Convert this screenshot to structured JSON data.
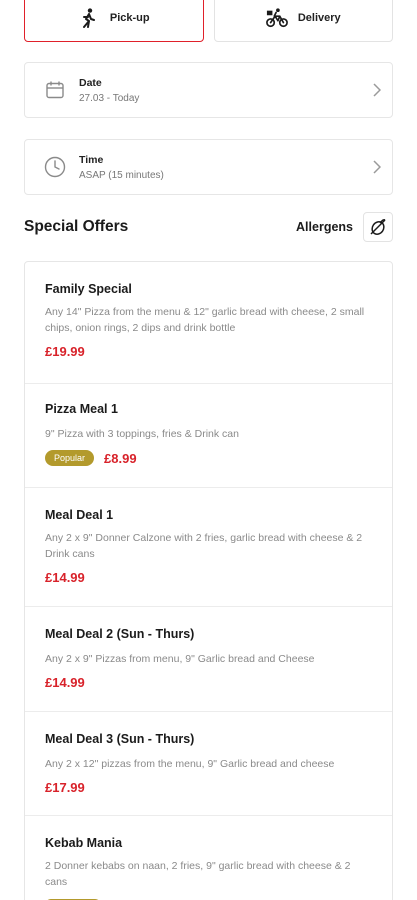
{
  "mode": {
    "pickup_label": "Pick-up",
    "delivery_label": "Delivery",
    "active": "pickup"
  },
  "date": {
    "title": "Date",
    "value": "27.03 - Today"
  },
  "time": {
    "title": "Time",
    "value": "ASAP (15 minutes)"
  },
  "offers": {
    "title": "Special Offers",
    "allergens_label": "Allergens",
    "items": [
      {
        "name": "Family Special",
        "desc": "Any 14\" Pizza from the menu & 12\" garlic bread with cheese, 2 small chips, onion rings, 2 dips and drink bottle",
        "price": "£19.99"
      },
      {
        "name": "Pizza Meal 1",
        "desc": "9\" Pizza with 3 toppings, fries & Drink can",
        "price": "£8.99",
        "badge": "Popular"
      },
      {
        "name": "Meal Deal 1",
        "desc": "Any 2 x 9\" Donner Calzone with 2 fries, garlic bread with cheese & 2 Drink cans",
        "price": "£14.99"
      },
      {
        "name": "Meal Deal 2 (Sun - Thurs)",
        "desc": "Any 2 x 9\" Pizzas from menu, 9\" Garlic bread and Cheese",
        "price": "£14.99"
      },
      {
        "name": "Meal Deal 3 (Sun - Thurs)",
        "desc": "Any 2 x 12\" pizzas from the menu, 9\" Garlic bread and cheese",
        "price": "£17.99"
      },
      {
        "name": "Kebab Mania",
        "desc": "2 Donner kebabs on naan, 2 fries, 9\" garlic bread with cheese & 2 cans",
        "price": ""
      }
    ]
  },
  "colors": {
    "accent": "#e0202a",
    "price": "#d8222a",
    "popular_badge": "#b39a2c"
  }
}
